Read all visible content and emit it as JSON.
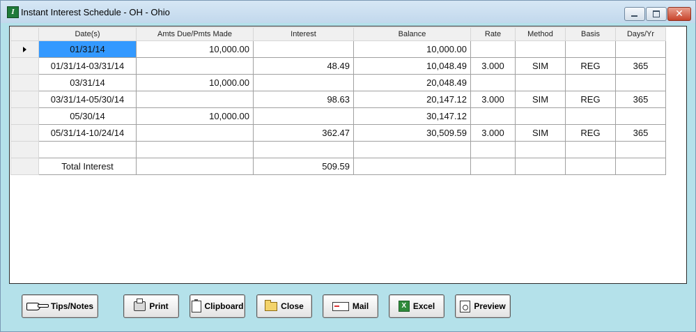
{
  "window": {
    "title": "Instant Interest Schedule - OH  - Ohio",
    "app_icon_glyph": "I",
    "close_glyph": "✕"
  },
  "grid": {
    "columns": [
      "Date(s)",
      "Amts Due/Pmts Made",
      "Interest",
      "Balance",
      "Rate",
      "Method",
      "Basis",
      "Days/Yr"
    ],
    "rows": [
      {
        "date": "01/31/14",
        "amount": "10,000.00",
        "interest": "",
        "balance": "10,000.00",
        "rate": "",
        "method": "",
        "basis": "",
        "days": ""
      },
      {
        "date": "01/31/14-03/31/14",
        "amount": "",
        "interest": "48.49",
        "balance": "10,048.49",
        "rate": "3.000",
        "method": "SIM",
        "basis": "REG",
        "days": "365"
      },
      {
        "date": "03/31/14",
        "amount": "10,000.00",
        "interest": "",
        "balance": "20,048.49",
        "rate": "",
        "method": "",
        "basis": "",
        "days": ""
      },
      {
        "date": "03/31/14-05/30/14",
        "amount": "",
        "interest": "98.63",
        "balance": "20,147.12",
        "rate": "3.000",
        "method": "SIM",
        "basis": "REG",
        "days": "365"
      },
      {
        "date": "05/30/14",
        "amount": "10,000.00",
        "interest": "",
        "balance": "30,147.12",
        "rate": "",
        "method": "",
        "basis": "",
        "days": ""
      },
      {
        "date": "05/31/14-10/24/14",
        "amount": "",
        "interest": "362.47",
        "balance": "30,509.59",
        "rate": "3.000",
        "method": "SIM",
        "basis": "REG",
        "days": "365"
      },
      {
        "date": "",
        "amount": "",
        "interest": "",
        "balance": "",
        "rate": "",
        "method": "",
        "basis": "",
        "days": ""
      },
      {
        "date": "Total Interest",
        "amount": "",
        "interest": "509.59",
        "balance": "",
        "rate": "",
        "method": "",
        "basis": "",
        "days": ""
      }
    ]
  },
  "buttons": {
    "tips": "Tips/Notes",
    "print": "Print",
    "clipboard": "Clipboard",
    "close": "Close",
    "mail": "Mail",
    "excel": "Excel",
    "preview": "Preview"
  },
  "icons": {
    "tips": "pointing-hand-icon",
    "print": "printer-icon",
    "clipboard": "clipboard-icon",
    "close": "folder-icon",
    "mail": "envelope-icon",
    "excel": "excel-icon",
    "excel_glyph": "X",
    "preview": "magnifier-page-icon"
  },
  "colors": {
    "window_bg": "#b4e1ea",
    "selected_cell": "#3399ff"
  }
}
